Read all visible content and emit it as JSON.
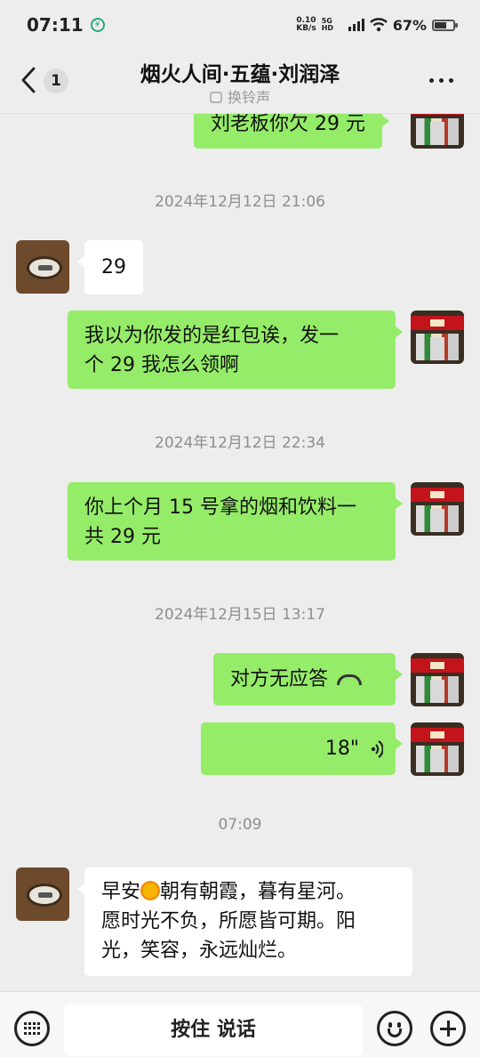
{
  "status_bar": {
    "time": "07:11",
    "net_speed_value": "0.10",
    "net_speed_unit": "KB/s",
    "network_label": "5G HD",
    "battery_text": "67%",
    "battery_level": 0.67
  },
  "header": {
    "back_badge": "1",
    "title": "烟火人间·五蕴·刘润泽",
    "subtitle": "换铃声"
  },
  "messages": [
    {
      "side": "right",
      "type": "text",
      "text": "刘老板你欠 29 元"
    },
    {
      "type": "timestamp",
      "text": "2024年12月12日 21:06"
    },
    {
      "side": "left",
      "type": "text",
      "text": "29"
    },
    {
      "side": "right",
      "type": "text",
      "lines": [
        "我以为你发的是红包诶，发一",
        "个 29 我怎么领啊"
      ]
    },
    {
      "type": "timestamp",
      "text": "2024年12月12日 22:34"
    },
    {
      "side": "right",
      "type": "text",
      "lines": [
        "你上个月 15 号拿的烟和饮料一",
        "共 29 元"
      ]
    },
    {
      "type": "timestamp",
      "text": "2024年12月15日 13:17"
    },
    {
      "side": "right",
      "type": "call",
      "text": "对方无应答"
    },
    {
      "side": "right",
      "type": "voice",
      "text": "18\""
    },
    {
      "type": "timestamp",
      "text": "07:09"
    },
    {
      "side": "left",
      "type": "text",
      "line1_a": "早安",
      "line1_b": "朝有朝霞，暮有星河。",
      "line2": "愿时光不负，所愿皆可期。阳",
      "line3": "光，笑容，永远灿烂。"
    }
  ],
  "bottom_bar": {
    "hold_to_talk": "按住 说话"
  }
}
